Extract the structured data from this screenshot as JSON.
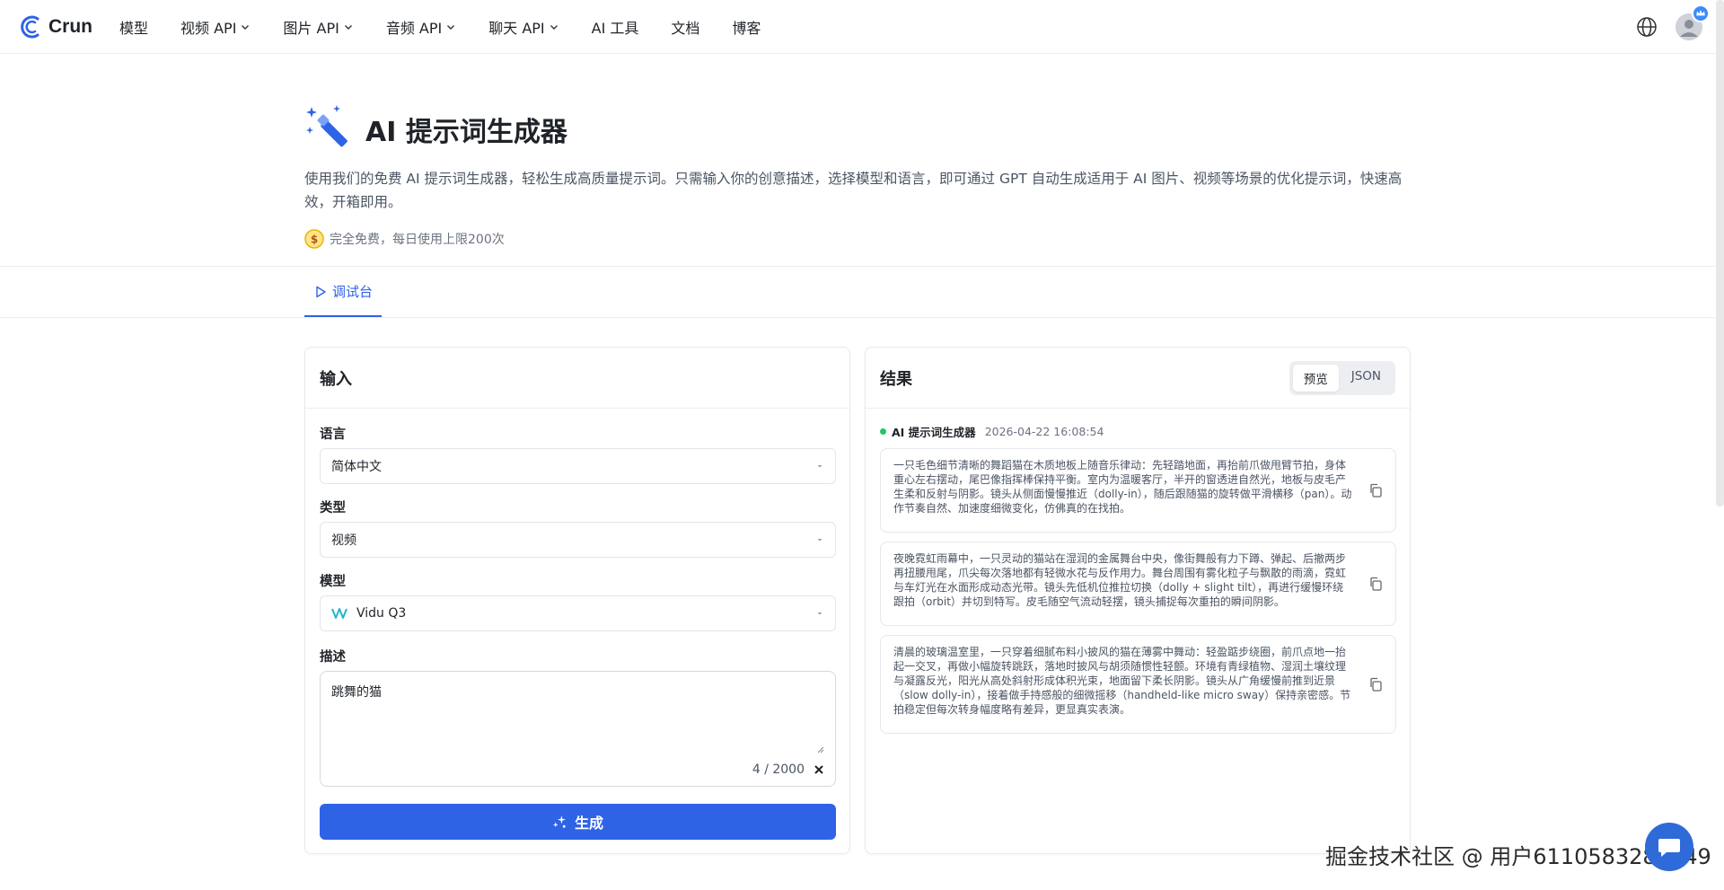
{
  "header": {
    "logo_text": "Crun",
    "nav": [
      {
        "label": "模型",
        "dropdown": false
      },
      {
        "label": "视频 API",
        "dropdown": true
      },
      {
        "label": "图片 API",
        "dropdown": true
      },
      {
        "label": "音频 API",
        "dropdown": true
      },
      {
        "label": "聊天 API",
        "dropdown": true
      },
      {
        "label": "AI 工具",
        "dropdown": false
      },
      {
        "label": "文档",
        "dropdown": false
      },
      {
        "label": "博客",
        "dropdown": false
      }
    ]
  },
  "hero": {
    "title": "AI 提示词生成器",
    "description": "使用我们的免费 AI 提示词生成器，轻松生成高质量提示词。只需输入你的创意描述，选择模型和语言，即可通过 GPT 自动生成适用于 AI 图片、视频等场景的优化提示词，快速高效，开箱即用。",
    "free_note": "完全免费，每日使用上限200次"
  },
  "tabs": [
    {
      "label": "调试台",
      "active": true
    }
  ],
  "input_panel": {
    "title": "输入",
    "language_label": "语言",
    "language_value": "简体中文",
    "type_label": "类型",
    "type_value": "视频",
    "model_label": "模型",
    "model_value": "Vidu Q3",
    "description_label": "描述",
    "description_value": "跳舞的猫",
    "char_count": "4 / 2000",
    "generate_label": "生成"
  },
  "result_panel": {
    "title": "结果",
    "view_tabs": [
      "预览",
      "JSON"
    ],
    "active_view": "预览",
    "source_name": "AI 提示词生成器",
    "timestamp": "2026-04-22 16:08:54",
    "results": [
      "一只毛色细节清晰的舞蹈猫在木质地板上随音乐律动：先轻踏地面，再抬前爪做甩臂节拍，身体重心左右摆动，尾巴像指挥棒保持平衡。室内为温暖客厅，半开的窗透进自然光，地板与皮毛产生柔和反射与阴影。镜头从侧面慢慢推近（dolly-in），随后跟随猫的旋转做平滑横移（pan）。动作节奏自然、加速度细微变化，仿佛真的在找拍。",
      "夜晚霓虹雨幕中，一只灵动的猫站在湿润的金属舞台中央，像街舞般有力下蹲、弹起、后撤两步再扭腰甩尾，爪尖每次落地都有轻微水花与反作用力。舞台周围有雾化粒子与飘散的雨滴，霓虹与车灯光在水面形成动态光带。镜头先低机位推拉切换（dolly + slight tilt），再进行缓慢环绕跟拍（orbit）并切到特写。皮毛随空气流动轻摆，镜头捕捉每次重拍的瞬间阴影。",
      "清晨的玻璃温室里，一只穿着细腻布料小披风的猫在薄雾中舞动：轻盈踮步绕圈，前爪点地一抬起一交叉，再做小幅旋转跳跃，落地时披风与胡须随惯性轻颤。环境有青绿植物、湿润土壤纹理与凝露反光，阳光从高处斜射形成体积光束，地面留下柔长阴影。镜头从广角缓慢前推到近景（slow dolly-in），接着做手持感般的细微摇移（handheld-like micro sway）保持亲密感。节拍稳定但每次转身幅度略有差异，更显真实表演。"
    ]
  },
  "watermark": "掘金技术社区 @ 用户6110583283949",
  "colors": {
    "accent": "#2f63e6",
    "status": "#22c55e"
  }
}
